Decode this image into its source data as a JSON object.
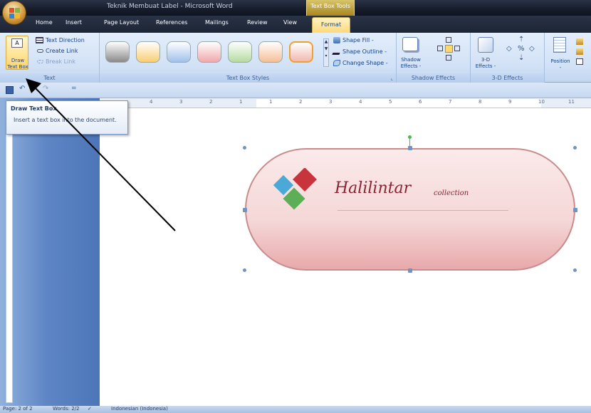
{
  "window": {
    "title": "Teknik Membuat Label - Microsoft Word",
    "contextual_tab_group": "Text Box Tools"
  },
  "tabs": [
    {
      "label": "Home"
    },
    {
      "label": "Insert"
    },
    {
      "label": "Page Layout"
    },
    {
      "label": "References"
    },
    {
      "label": "Mailings"
    },
    {
      "label": "Review"
    },
    {
      "label": "View"
    },
    {
      "label": "Format"
    }
  ],
  "ribbon": {
    "text_group": {
      "label": "Text",
      "draw_line1": "Draw",
      "draw_line2": "Text Box",
      "text_direction": "Text Direction",
      "create_link": "Create Link",
      "break_link": "Break Link"
    },
    "styles_group": {
      "label": "Text Box Styles",
      "shape_fill": "Shape Fill -",
      "shape_outline": "Shape Outline -",
      "change_shape": "Change Shape -",
      "swatches": [
        "#8a8a8a",
        "#f8cf72",
        "#9fc1ea",
        "#f0a8ab",
        "#b5dba0",
        "#f5bf96",
        "#f0b9b0"
      ]
    },
    "shadow_group": {
      "label": "Shadow Effects",
      "button_line1": "Shadow",
      "button_line2": "Effects -"
    },
    "threed_group": {
      "label": "3-D Effects",
      "button_line1": "3-D",
      "button_line2": "Effects -"
    },
    "arrange_group": {
      "position": "Position",
      "position_arrow": "-"
    }
  },
  "qat": {
    "dropdown_glyph": "="
  },
  "ruler": {
    "numbers": [
      "4",
      "3",
      "2",
      "1",
      "1",
      "2",
      "3",
      "4",
      "5",
      "6",
      "7",
      "8",
      "9",
      "10",
      "11"
    ]
  },
  "tooltip": {
    "title": "Draw Text Box",
    "description": "Insert a text box into the document."
  },
  "document": {
    "label_main": "Halilintar",
    "label_sub": "collection"
  },
  "status": {
    "page": "Page: 2 of 2",
    "words": "Words: 2/2",
    "language": "Indonesian (Indonesia)"
  },
  "colors": {
    "accent": "#15428b",
    "label_text": "#8b2232"
  }
}
